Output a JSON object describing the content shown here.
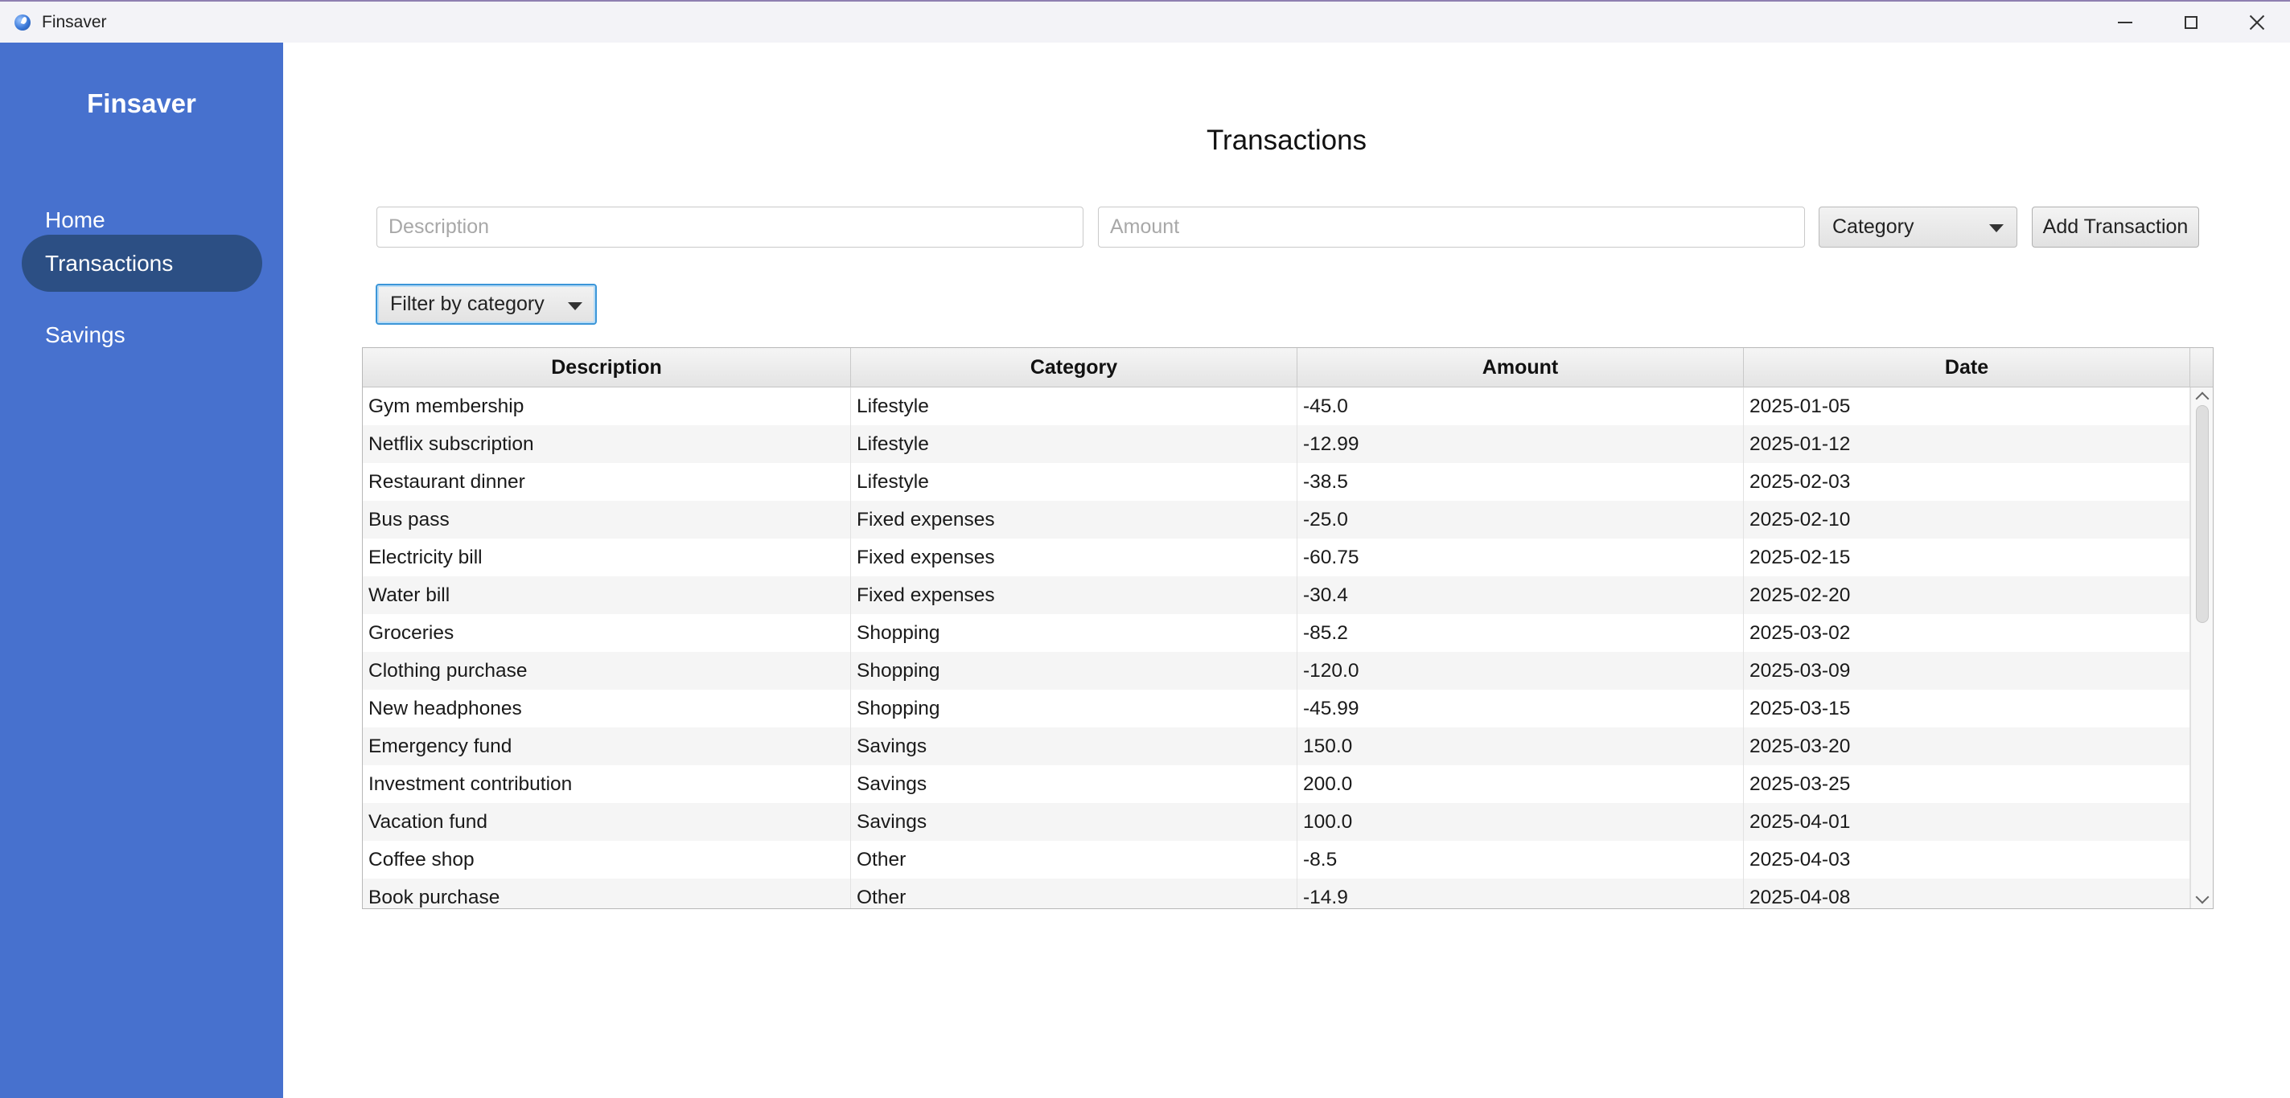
{
  "window": {
    "title": "Finsaver"
  },
  "sidebar": {
    "brand": "Finsaver",
    "items": [
      {
        "label": "Home",
        "active": false
      },
      {
        "label": "Transactions",
        "active": true
      },
      {
        "label": "Savings",
        "active": false
      }
    ]
  },
  "main": {
    "title": "Transactions",
    "form": {
      "description_placeholder": "Description",
      "description_value": "",
      "amount_placeholder": "Amount",
      "amount_value": "",
      "category_selected": "Category",
      "add_button_label": "Add Transaction"
    },
    "filter": {
      "selected": "Filter by category"
    },
    "table": {
      "columns": [
        "Description",
        "Category",
        "Amount",
        "Date"
      ],
      "rows": [
        [
          "Gym membership",
          "Lifestyle",
          "-45.0",
          "2025-01-05"
        ],
        [
          "Netflix subscription",
          "Lifestyle",
          "-12.99",
          "2025-01-12"
        ],
        [
          "Restaurant dinner",
          "Lifestyle",
          "-38.5",
          "2025-02-03"
        ],
        [
          "Bus pass",
          "Fixed expenses",
          "-25.0",
          "2025-02-10"
        ],
        [
          "Electricity bill",
          "Fixed expenses",
          "-60.75",
          "2025-02-15"
        ],
        [
          "Water bill",
          "Fixed expenses",
          "-30.4",
          "2025-02-20"
        ],
        [
          "Groceries",
          "Shopping",
          "-85.2",
          "2025-03-02"
        ],
        [
          "Clothing purchase",
          "Shopping",
          "-120.0",
          "2025-03-09"
        ],
        [
          "New headphones",
          "Shopping",
          "-45.99",
          "2025-03-15"
        ],
        [
          "Emergency fund",
          "Savings",
          "150.0",
          "2025-03-20"
        ],
        [
          "Investment contribution",
          "Savings",
          "200.0",
          "2025-03-25"
        ],
        [
          "Vacation fund",
          "Savings",
          "100.0",
          "2025-04-01"
        ],
        [
          "Coffee shop",
          "Other",
          "-8.5",
          "2025-04-03"
        ],
        [
          "Book purchase",
          "Other",
          "-14.9",
          "2025-04-08"
        ]
      ]
    }
  },
  "colors": {
    "sidebar_bg": "#4771ce",
    "sidebar_active_bg": "#2c4f84",
    "focus_border": "#3c96d8"
  },
  "icons": {
    "app": "finsaver-app-icon",
    "minimize": "minimize-icon",
    "maximize": "maximize-icon",
    "close": "close-icon",
    "dropdown": "chevron-down-icon"
  }
}
